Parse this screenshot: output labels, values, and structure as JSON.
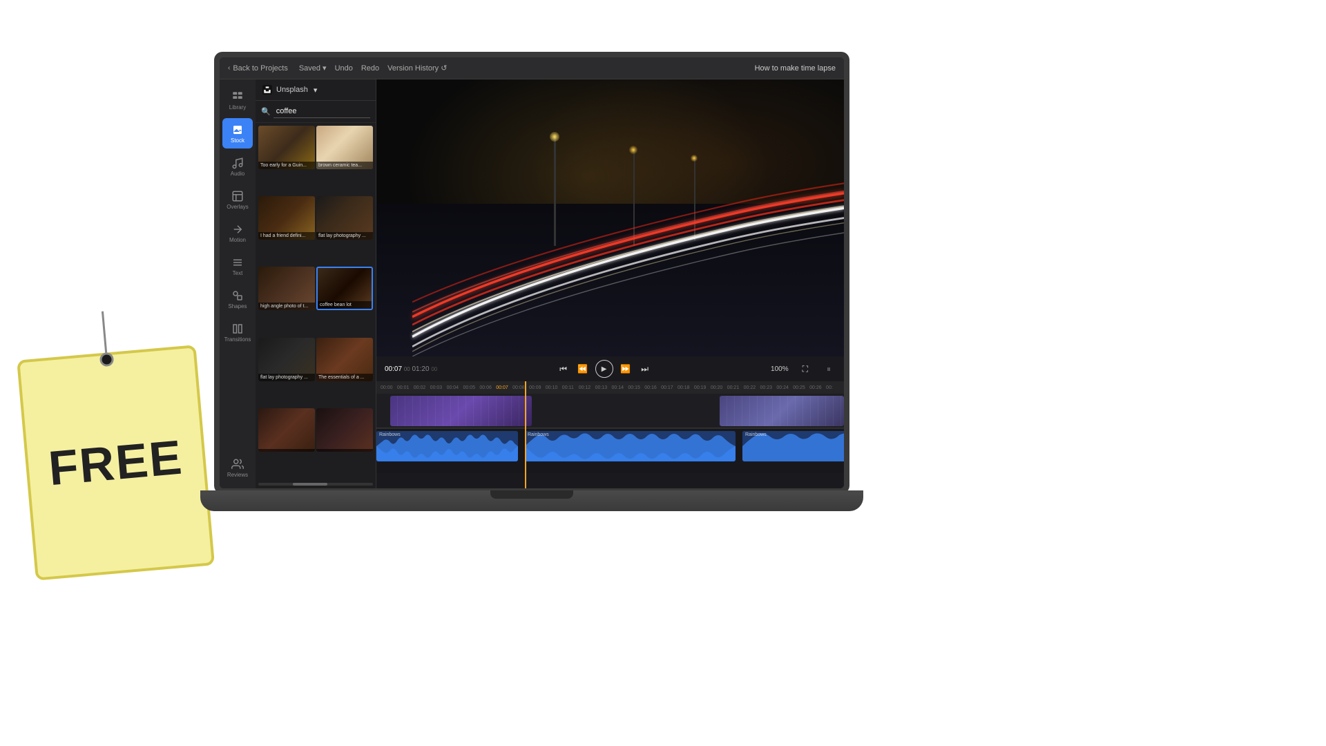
{
  "topBar": {
    "backLabel": "Back to Projects",
    "savedLabel": "Saved",
    "undoLabel": "Undo",
    "redoLabel": "Redo",
    "versionLabel": "Version History",
    "projectTitle": "How to make time lapse"
  },
  "sidebar": {
    "items": [
      {
        "id": "library",
        "label": "Library",
        "active": false
      },
      {
        "id": "stock",
        "label": "Stock",
        "active": true
      },
      {
        "id": "audio",
        "label": "Audio",
        "active": false
      },
      {
        "id": "overlays",
        "label": "Overlays",
        "active": false
      },
      {
        "id": "motion",
        "label": "Motion",
        "active": false
      },
      {
        "id": "text",
        "label": "Text",
        "active": false
      },
      {
        "id": "shapes",
        "label": "Shapes",
        "active": false
      },
      {
        "id": "transitions",
        "label": "Transitions",
        "active": false
      },
      {
        "id": "reviews",
        "label": "Reviews",
        "active": false
      }
    ]
  },
  "stockPanel": {
    "provider": "Unsplash",
    "searchQuery": "coffee",
    "images": [
      {
        "id": 1,
        "caption": "Too early for a Guin..."
      },
      {
        "id": 2,
        "caption": "brown ceramic tea..."
      },
      {
        "id": 3,
        "caption": "I had a friend defini..."
      },
      {
        "id": 4,
        "caption": "flat lay photography ..."
      },
      {
        "id": 5,
        "caption": "high angle photo of t..."
      },
      {
        "id": 6,
        "caption": "coffee bean lot"
      },
      {
        "id": 7,
        "caption": "flat lay photography ..."
      },
      {
        "id": 8,
        "caption": "The essentials of a ..."
      },
      {
        "id": 9,
        "caption": ""
      },
      {
        "id": 10,
        "caption": ""
      }
    ]
  },
  "player": {
    "currentTime": "00:07",
    "currentFrames": "00",
    "totalTime": "01:20",
    "totalFrames": "00",
    "zoom": "100%"
  },
  "timeline": {
    "rulerMarks": [
      "00:00",
      "00:01",
      "00:02",
      "00:03",
      "00:04",
      "00:05",
      "00:06",
      "00:07",
      "00:08",
      "00:09",
      "00:10",
      "00:11",
      "00:12",
      "00:13",
      "00:14",
      "00:15",
      "00:16",
      "00:17",
      "00:18",
      "00:19",
      "00:20",
      "00:21",
      "00:22",
      "00:23",
      "00:24",
      "00:25",
      "00:26",
      "00:"
    ],
    "audioLabels": [
      "Rainbows",
      "Rainbows",
      "Rainbows"
    ]
  },
  "freeTag": {
    "text": "FREE"
  }
}
